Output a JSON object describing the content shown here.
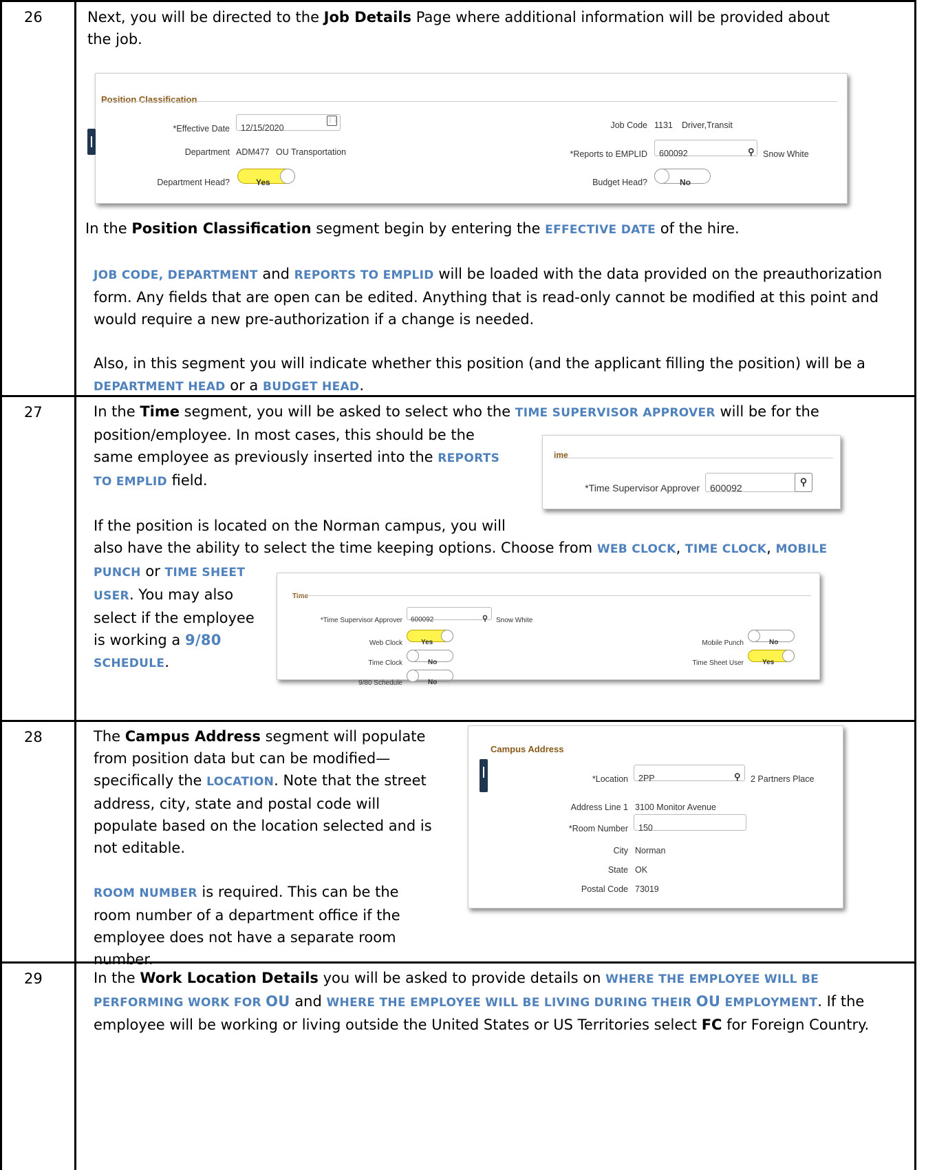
{
  "rows": [
    {
      "num": "26",
      "intro_a": "Next, you will be directed to the ",
      "intro_b": "Job Details",
      "intro_c": " Page where additional information will be provided about the job.",
      "p1_a": " In the ",
      "p1_b": "Position Classification",
      "p1_c": " segment begin by entering the ",
      "p1_sc": "Effective date",
      "p1_d": " of the hire.",
      "p2_sc1": "Job Code, Department",
      "p2_a": " and ",
      "p2_sc2": "Reports To EMPLID",
      "p2_b": " will be loaded with the data provided on the preauthorization form. Any fields that are open can be edited. Anything that is read-only cannot be modified at this point and would require a new pre-authorization if a change is needed.",
      "p3_a": "Also, in this segment you will indicate whether this position (and the applicant filling the position) will be a ",
      "p3_sc1": "Department Head",
      "p3_b": " or a ",
      "p3_sc2": "Budget Head",
      "p3_c": "."
    },
    {
      "num": "27",
      "p1_a": "In the ",
      "p1_b": "Time",
      "p1_c": " segment, you will be asked to select who the ",
      "p1_sc": "time supervisor approver",
      "p1_d": " will be for the",
      "p1_e": "position/employee. In most cases, this should be the",
      "p1_f": "same employee as previously inserted into the ",
      "p1_sc2a": "Reports",
      "p1_sc2b": "to Emplid",
      "p1_g": " field.",
      "p2_a": "If the position is located on the Norman campus,  you will",
      "p2_b": "also have the ability to select the time keeping options.  Choose from ",
      "p2_sc1": "web clock",
      "p2_sep1": ", ",
      "p2_sc2": "time clock",
      "p2_sep2": ", ",
      "p2_sc3": "mobile",
      "p2_sc3b": "punch",
      "p2_or": " or ",
      "p2_sc4": "time sheet",
      "p2_sc4b": "user",
      "p2_c": ".  You may also",
      "p2_d": "select if the employee",
      "p2_e": "is working a ",
      "p2_sc5": "9/80",
      "p2_sc5b": "schedule",
      "p2_f": "."
    },
    {
      "num": "28",
      "l1_a": "The ",
      "l1_b": "Campus Address",
      "l1_c": " segment will populate",
      "l2": "from position data but can be modified—",
      "l3_a": "specifically the ",
      "l3_sc": "Location",
      "l3_b": ". Note that the street",
      "l4": "address, city, state and postal code will",
      "l5": "populate based on the location selected and is",
      "l6": "not editable.",
      "l7_sc": "Room Number",
      "l7_b": " is required. This can be the",
      "l8": "room number of a department office if the",
      "l9": "employee does not have a separate room",
      "l10": "number."
    },
    {
      "num": "29",
      "a": "In the ",
      "b": "Work Location Details",
      "c": " you will be asked to provide details on ",
      "sc1a": "where the employee will be performing work for ",
      "sc1b": "OU",
      "d": " and ",
      "sc2a": "where the employee will be living during their ",
      "sc2b": "OU",
      "sc2c": " employment",
      "e": ". If the employee will be working or living outside the United States or US Territories select ",
      "f": "FC",
      "g": " for Foreign Country."
    }
  ],
  "position_classification": {
    "header": "Position Classification",
    "effective_date_label": "*Effective Date",
    "effective_date_value": "12/15/2020",
    "department_label": "Department",
    "department_code": "ADM477",
    "department_name": "OU Transportation",
    "department_head_label": "Department Head?",
    "department_head_value": "Yes",
    "job_code_label": "Job Code",
    "job_code_value": "1131",
    "job_code_name": "Driver,Transit",
    "reports_to_label": "*Reports to EMPLID",
    "reports_to_value": "600092",
    "reports_to_name": "Snow White",
    "budget_head_label": "Budget Head?",
    "budget_head_value": "No"
  },
  "time_small": {
    "header": "ime",
    "approver_label": "*Time Supervisor Approver",
    "approver_value": "600092"
  },
  "time_full": {
    "header": "Time",
    "approver_label": "*Time Supervisor Approver",
    "approver_value": "600092",
    "approver_name": "Snow White",
    "web_clock_label": "Web Clock",
    "web_clock_value": "Yes",
    "time_clock_label": "Time Clock",
    "time_clock_value": "No",
    "schedule_label": "9/80 Schedule",
    "schedule_value": "No",
    "mobile_punch_label": "Mobile Punch",
    "mobile_punch_value": "No",
    "time_sheet_label": "Time Sheet User",
    "time_sheet_value": "Yes"
  },
  "campus_address": {
    "header": "Campus Address",
    "location_label": "*Location",
    "location_value": "2PP",
    "location_name": "2 Partners Place",
    "address_label": "Address Line 1",
    "address_value": "3100 Monitor Avenue",
    "room_label": "*Room Number",
    "room_value": "150",
    "city_label": "City",
    "city_value": "Norman",
    "state_label": "State",
    "state_value": "OK",
    "postal_label": "Postal Code",
    "postal_value": "73019"
  }
}
